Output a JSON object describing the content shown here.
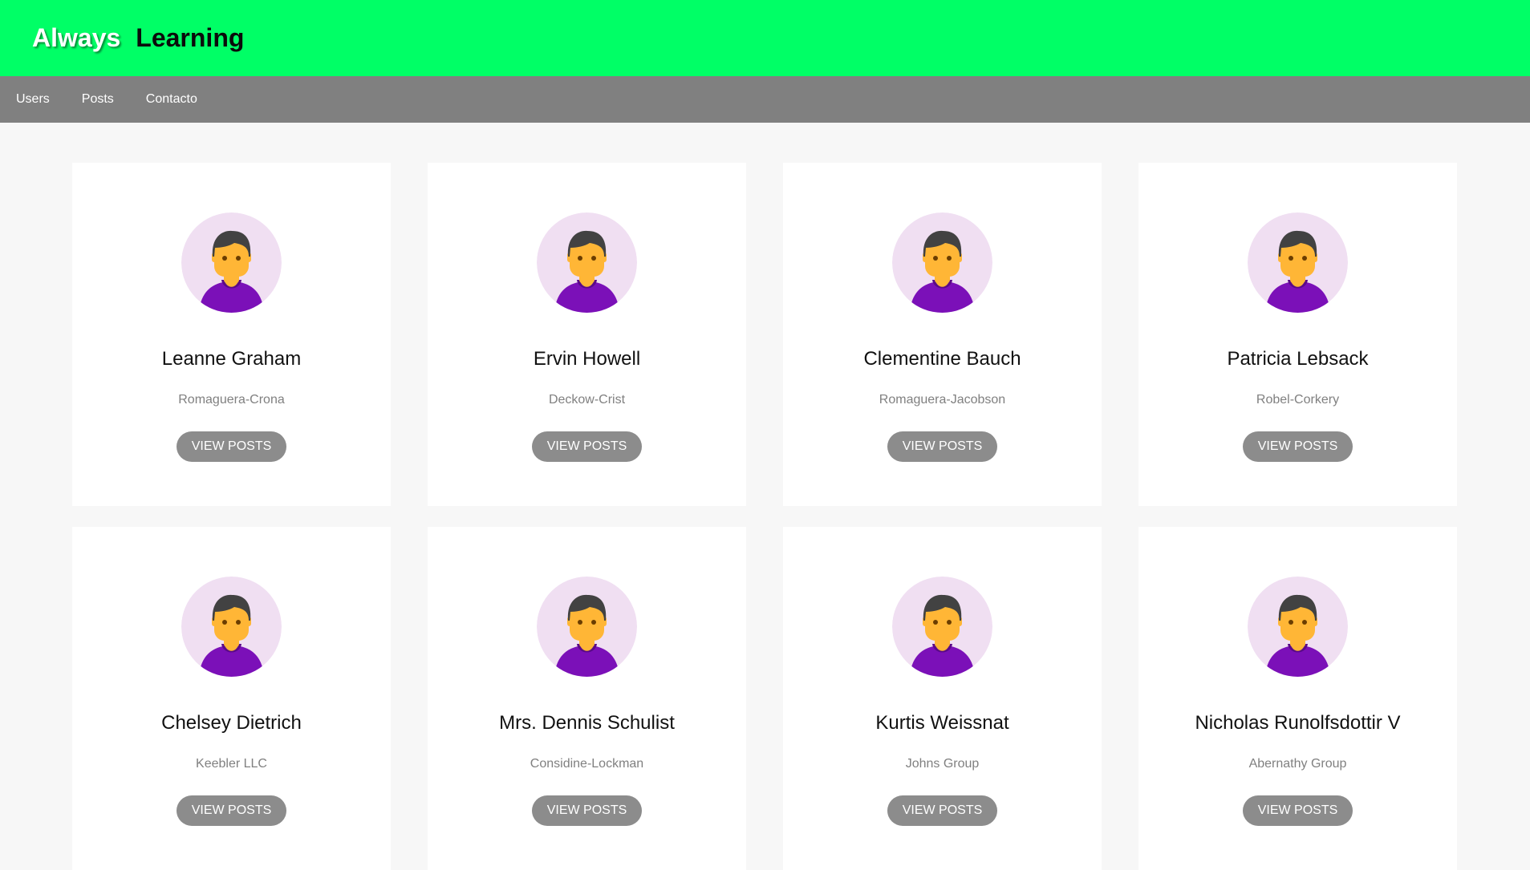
{
  "colors": {
    "header_bg": "#00ff66",
    "nav_bg": "#808080",
    "button_bg": "#8c8c8c",
    "avatar_bg": "#f0dff2",
    "avatar_shirt": "#7b10b8",
    "avatar_skin": "#ffb636",
    "avatar_hair": "#424242"
  },
  "header": {
    "brand_first": "Always",
    "brand_second": "Learning"
  },
  "nav": {
    "items": [
      {
        "label": "Users"
      },
      {
        "label": "Posts"
      },
      {
        "label": "Contacto"
      }
    ]
  },
  "users": [
    {
      "name": "Leanne Graham",
      "company": "Romaguera-Crona",
      "button": "VIEW POSTS",
      "avatar_icon": "user-avatar-icon"
    },
    {
      "name": "Ervin Howell",
      "company": "Deckow-Crist",
      "button": "VIEW POSTS",
      "avatar_icon": "user-avatar-icon"
    },
    {
      "name": "Clementine Bauch",
      "company": "Romaguera-Jacobson",
      "button": "VIEW POSTS",
      "avatar_icon": "user-avatar-icon"
    },
    {
      "name": "Patricia Lebsack",
      "company": "Robel-Corkery",
      "button": "VIEW POSTS",
      "avatar_icon": "user-avatar-icon"
    },
    {
      "name": "Chelsey Dietrich",
      "company": "Keebler LLC",
      "button": "VIEW POSTS",
      "avatar_icon": "user-avatar-icon"
    },
    {
      "name": "Mrs. Dennis Schulist",
      "company": "Considine-Lockman",
      "button": "VIEW POSTS",
      "avatar_icon": "user-avatar-icon"
    },
    {
      "name": "Kurtis Weissnat",
      "company": "Johns Group",
      "button": "VIEW POSTS",
      "avatar_icon": "user-avatar-icon"
    },
    {
      "name": "Nicholas Runolfsdottir V",
      "company": "Abernathy Group",
      "button": "VIEW POSTS",
      "avatar_icon": "user-avatar-icon"
    }
  ]
}
